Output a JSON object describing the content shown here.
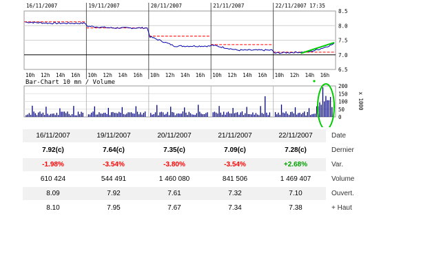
{
  "price_chart": {
    "dates": [
      "16/11/2007",
      "19/11/2007",
      "20/11/2007",
      "21/11/2007",
      "22/11/2007 17:35"
    ],
    "hours": [
      "10h",
      "12h",
      "14h",
      "16h"
    ],
    "y_ticks": [
      "8.5",
      "8.0",
      "7.5",
      "7.0",
      "6.5"
    ]
  },
  "volume_chart": {
    "title": "Bar-Chart 10 mn / Volume",
    "unit": "x 1000",
    "y_ticks": [
      "200",
      "150",
      "100",
      "50",
      "0"
    ]
  },
  "chart_data": [
    {
      "type": "line",
      "title": "",
      "xlabel": "",
      "ylabel": "",
      "x": [
        "16/11/2007",
        "19/11/2007",
        "20/11/2007",
        "21/11/2007",
        "22/11/2007"
      ],
      "ylim": [
        6.5,
        8.5
      ],
      "series": [
        {
          "values": [
            8.08,
            7.92,
            7.3,
            7.16,
            7.38
          ]
        }
      ],
      "reference_lines": [
        8.13,
        7.92,
        7.64,
        7.35,
        7.09
      ],
      "baseline": 7.0
    },
    {
      "type": "bar",
      "title": "Bar-Chart 10 mn / Volume",
      "ylabel": "x 1000",
      "ylim": [
        0,
        200
      ],
      "values": []
    }
  ],
  "table": {
    "row_labels": [
      "Date",
      "Dernier",
      "Var.",
      "Volume",
      "Ouvert.",
      "+ Haut"
    ],
    "columns": [
      {
        "date": "16/11/2007",
        "dernier": "7.92(c)",
        "var": "-1.98%",
        "volume": "610 424",
        "ouvert": "8.09",
        "haut": "8.10"
      },
      {
        "date": "19/11/2007",
        "dernier": "7.64(c)",
        "var": "-3.54%",
        "volume": "544 491",
        "ouvert": "7.92",
        "haut": "7.95"
      },
      {
        "date": "20/11/2007",
        "dernier": "7.35(c)",
        "var": "-3.80%",
        "volume": "1 460 080",
        "ouvert": "7.61",
        "haut": "7.67"
      },
      {
        "date": "21/11/2007",
        "dernier": "7.09(c)",
        "var": "-3.54%",
        "volume": "841 506",
        "ouvert": "7.32",
        "haut": "7.34"
      },
      {
        "date": "22/11/2007",
        "dernier": "7.28(c)",
        "var": "+2.68%",
        "volume": "1 469 407",
        "ouvert": "7.10",
        "haut": "7.38"
      }
    ]
  },
  "colors": {
    "price_line": "#0000aa",
    "prev_close": "#ff0000",
    "trend": "#00cc00",
    "volume_bar": "#000080",
    "highlight": "#00cc00"
  }
}
